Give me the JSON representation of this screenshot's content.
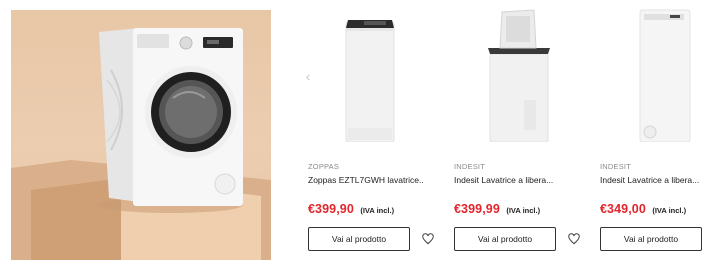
{
  "carousel": {
    "prev_icon": "chevron-left-icon"
  },
  "products": [
    {
      "brand": "ZOPPAS",
      "title": "Zoppas EZTL7GWH lavatrice...",
      "price": "€399,90",
      "vat": "(IVA incl.)",
      "cta": "Vai al prodotto",
      "wishlist_icon": "heart-icon"
    },
    {
      "brand": "INDESIT",
      "title": "Indesit Lavatrice a libera...",
      "price": "€399,99",
      "vat": "(IVA incl.)",
      "cta": "Vai al prodotto",
      "wishlist_icon": "heart-icon"
    },
    {
      "brand": "INDESIT",
      "title": "Indesit Lavatrice a libera...",
      "price": "€349,00",
      "vat": "(IVA incl.)",
      "cta": "Vai al prodotto"
    }
  ],
  "colors": {
    "price": "#e3242b",
    "hero_background": "#e8c7a6",
    "button_border": "#333333"
  }
}
